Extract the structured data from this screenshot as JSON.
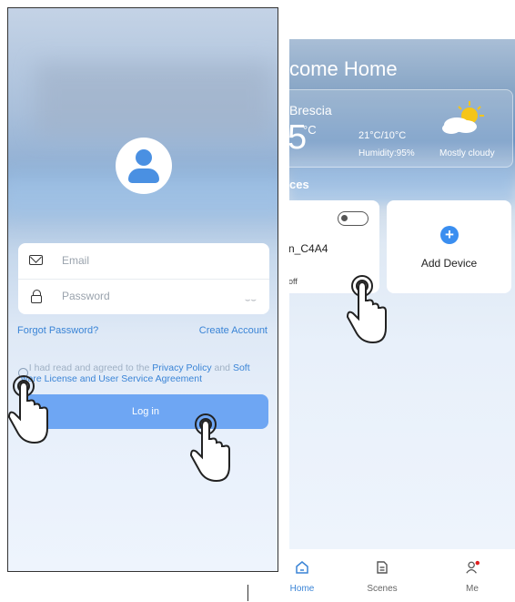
{
  "login": {
    "email_placeholder": "Email",
    "password_placeholder": "Password",
    "forgot_password": "Forgot Password?",
    "create_account": "Create Account",
    "agreement": {
      "prefix": "I had read and agreed to the",
      "privacy_policy": "Privacy Policy",
      "and": "and",
      "software_license": "Soft ware License and User Service Agreement"
    },
    "login_button": "Log in"
  },
  "home": {
    "welcome": "come Home",
    "weather": {
      "city": "Brescia",
      "temperature": "5",
      "unit": "°C",
      "range": "21°C/10°C",
      "humidity": "Humidity:95%",
      "condition": "Mostly cloudy",
      "icon": "partly-cloudy-sun-icon"
    },
    "devices_heading": "ces",
    "device": {
      "name": "n_C4A4",
      "status": "off",
      "toggle_on": false
    },
    "add_device_label": "Add Device",
    "tabs": [
      {
        "label": "Home",
        "icon": "home-icon",
        "active": true
      },
      {
        "label": "Scenes",
        "icon": "scenes-icon",
        "active": false
      },
      {
        "label": "Me",
        "icon": "user-icon",
        "active": false,
        "notification": true
      }
    ]
  },
  "colors": {
    "accent": "#3a84d6",
    "button": "#6ea6f3",
    "badge": "#e02020"
  }
}
